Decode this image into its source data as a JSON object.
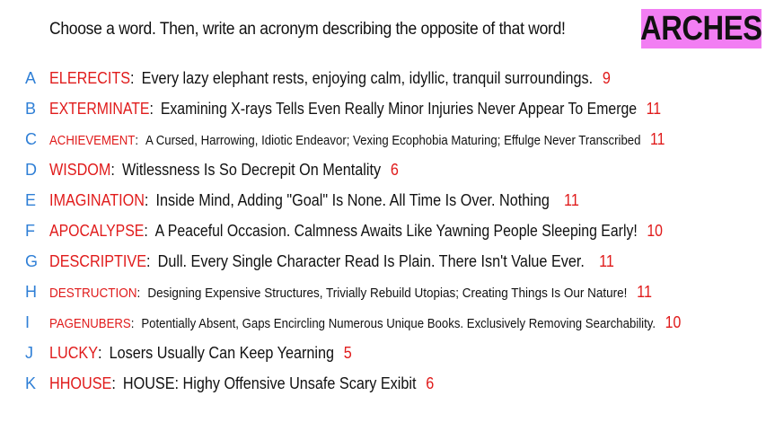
{
  "instruction": "Choose a word. Then, write an acronym describing the opposite of that word!",
  "brand": "ARCHES",
  "colors": {
    "letter": "#2f7fd6",
    "word": "#e01b1b",
    "text": "#111111",
    "brand_bg": "#f27ef3"
  },
  "entries": [
    {
      "letter": "A",
      "word": "ELERECITS",
      "acronym": "Every lazy elephant rests, enjoying calm, idyllic, tranquil surroundings.",
      "count": "9"
    },
    {
      "letter": "B",
      "word": "EXTERMINATE",
      "acronym": "Examining X-rays Tells Even Really Minor Injuries Never Appear To Emerge",
      "count": "11"
    },
    {
      "letter": "C",
      "word": "ACHIEVEMENT",
      "acronym": "A Cursed, Harrowing, Idiotic Endeavor; Vexing Ecophobia Maturing; Effulge Never Transcribed",
      "count": "11"
    },
    {
      "letter": "D",
      "word": "WISDOM",
      "acronym": "Witlessness Is So Decrepit On Mentality",
      "count": "6"
    },
    {
      "letter": "E",
      "word": "IMAGINATION",
      "acronym": "Inside Mind, Adding \"Goal\" Is None. All Time Is Over. Nothing",
      "count": "11"
    },
    {
      "letter": "F",
      "word": "APOCALYPSE",
      "acronym": "A Peaceful Occasion. Calmness Awaits Like Yawning People Sleeping Early!",
      "count": "10"
    },
    {
      "letter": "G",
      "word": "DESCRIPTIVE",
      "acronym": "Dull. Every Single Character Read Is Plain. There Isn't Value Ever.",
      "count": "11"
    },
    {
      "letter": "H",
      "word": "DESTRUCTION",
      "acronym": "Designing Expensive Structures, Trivially Rebuild Utopias; Creating Things Is Our Nature!",
      "count": "11"
    },
    {
      "letter": "I",
      "word": "PAGENUBERS",
      "acronym": "Potentially Absent, Gaps Encircling Numerous Unique Books. Exclusively Removing Searchability.",
      "count": "10"
    },
    {
      "letter": "J",
      "word": "LUCKY",
      "acronym": "Losers Usually Can Keep Yearning",
      "count": "5"
    },
    {
      "letter": "K",
      "word": "HHOUSE",
      "acronym": "HOUSE: Highy Offensive Unsafe Scary Exibit",
      "count": "6"
    }
  ]
}
